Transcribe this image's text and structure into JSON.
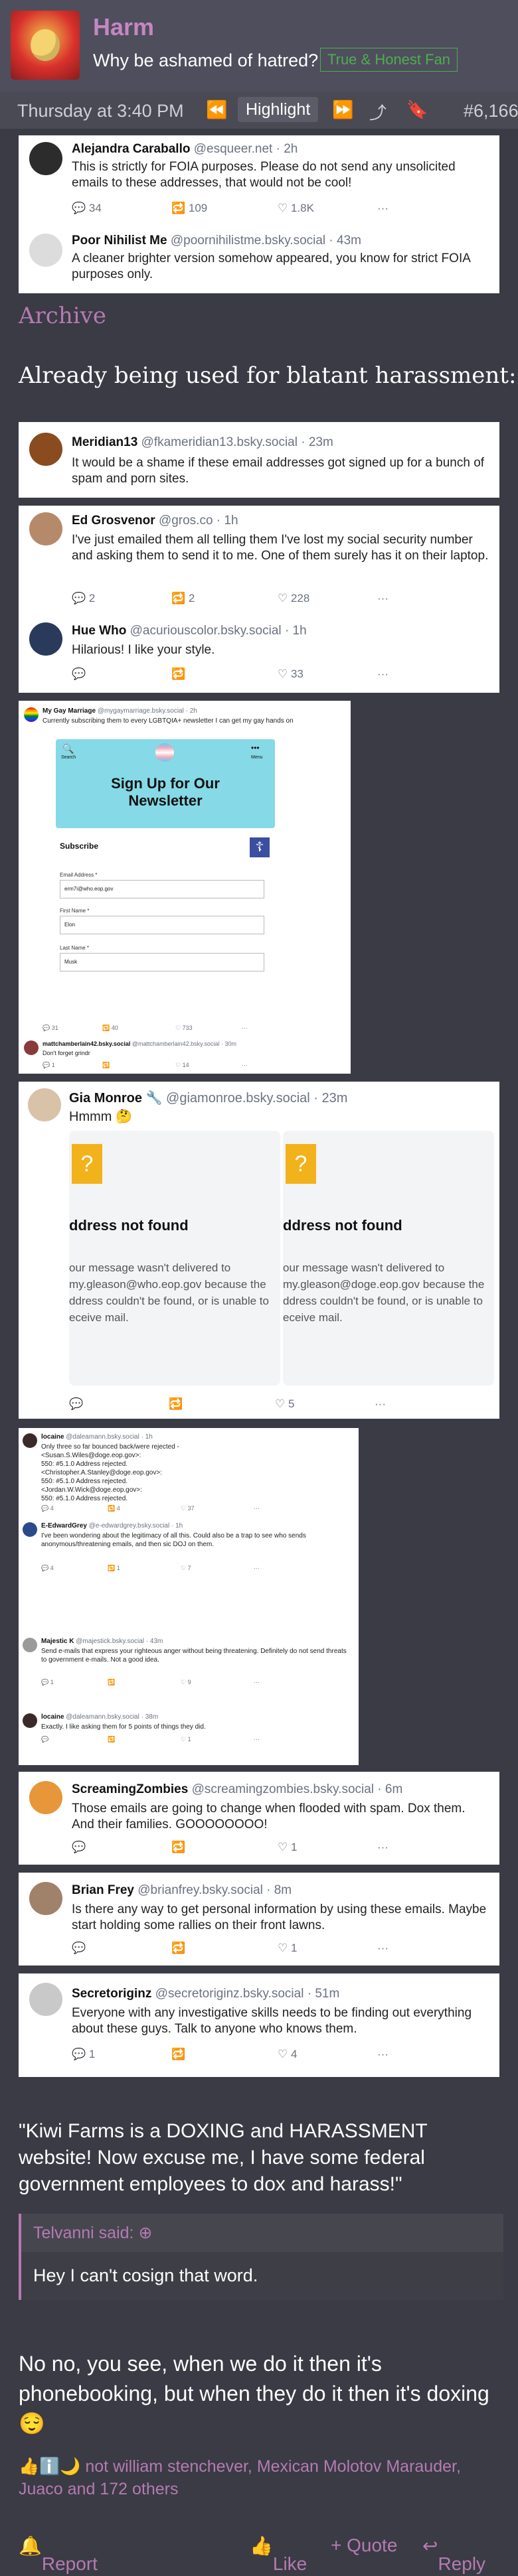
{
  "header": {
    "username": "Harm",
    "user_title": "Why be ashamed of hatred?",
    "badge": "True & Honest Fan"
  },
  "meta": {
    "time": "Thursday at 3:40 PM",
    "highlight": "Highlight",
    "post_number": "#6,166"
  },
  "tweets_top": [
    {
      "name": "Alejandra Caraballo",
      "handle": "@esqueer.net · 2h",
      "text": "This is strictly for FOIA purposes. Please do not send any unsolicited emails to these addresses, that would not be cool!",
      "replies": "34",
      "reposts": "109",
      "likes": "1.8K"
    },
    {
      "name": "Poor Nihilist Me",
      "handle": "@poornihilistme.bsky.social · 43m",
      "text": "A cleaner brighter version somehow appeared, you know for strict FOIA purposes only."
    }
  ],
  "archive_label": "Archive",
  "blatant_label": "Already being used for blatant harassment:",
  "meridian": {
    "name": "Meridian13",
    "handle": "@fkameridian13.bsky.social · 23m",
    "text": "It would be a shame if these email addresses got signed up for a bunch of spam and porn sites."
  },
  "grosvenor": {
    "name": "Ed Grosvenor",
    "handle": "@gros.co · 1h",
    "text": "I've just emailed them all telling them I've lost my social security number and asking them to send it to me. One of them surely has it on their laptop.",
    "replies": "2",
    "reposts": "2",
    "likes": "228"
  },
  "huewho": {
    "name": "Hue Who",
    "handle": "@acuriouscolor.bsky.social · 1h",
    "text": "Hilarious! I like your style.",
    "likes": "33"
  },
  "marriage": {
    "name": "My Gay Marriage",
    "handle": "@mygaymarriage.bsky.social · 2h",
    "text": "Currently subscribing them to every LGBTQIA+ newsletter I can get my gay hands on",
    "search": "Search",
    "menu": "Menu",
    "newsletter": "Sign Up for Our Newsletter",
    "subscribe": "Subscribe",
    "email_label": "Email Address *",
    "email_value": "erm7i@who.eop.gov",
    "first_label": "First Name *",
    "first_value": "Elon",
    "last_label": "Last Name *",
    "last_value": "Musk",
    "replies": "31",
    "reposts": "40",
    "likes": "733",
    "reply_name": "mattchamberlain42.bsky.social",
    "reply_handle": "@mattchamberlain42.bsky.social · 30m",
    "reply_text": "Don't forget grindr",
    "reply_replies": "1",
    "reply_likes": "14"
  },
  "gia": {
    "name": "Gia Monroe",
    "handle": "@giamonroe.bsky.social · 23m",
    "text": "Hmmm 🤔",
    "nf_title": "ddress not found",
    "nf_left": "our message wasn't delivered to my.gleason@who.eop.gov because the ddress couldn't be found, or is unable to eceive mail.",
    "nf_right": "our message wasn't delivered to my.gleason@doge.eop.gov because the ddress couldn't be found, or is unable to eceive mail.",
    "likes": "5"
  },
  "locaine": {
    "name": "locaine",
    "handle": "@daleamann.bsky.social · 1h",
    "lines": [
      "Only three so far bounced back/were rejected -",
      "<Susan.S.Wiles@doge.eop.gov>:",
      "550: #5.1.0 Address rejected.",
      "<Christopher.A.Stanley@doge.eop.gov>:",
      "550: #5.1.0 Address rejected.",
      "<Jordan.W.Wick@doge.eop.gov>:",
      "550: #5.1.0 Address rejected."
    ],
    "replies": "4",
    "reposts": "4",
    "likes": "37",
    "e_name": "E-EdwardGrey",
    "e_handle": "@e-edwardgrey.bsky.social · 1h",
    "e_text": "I've been wondering about the legitimacy of all this. Could also be a trap to see who sends anonymous/threatening emails, and then sic DOJ on them.",
    "e_replies": "4",
    "e_reposts": "1",
    "e_likes": "7",
    "m_name": "Majestic K",
    "m_handle": "@majestick.bsky.social · 43m",
    "m_text": "Send e-mails that express your righteous anger without being threatening. Definitely do not send threats to government e-mails. Not a good idea.",
    "m_replies": "1",
    "m_likes": "9",
    "l2_name": "locaine",
    "l2_handle": "@daleamann.bsky.social · 38m",
    "l2_text": "Exactly. I like asking them for 5 points of things they did.",
    "l2_likes": "1"
  },
  "zombies": {
    "name": "ScreamingZombies",
    "handle": "@screamingzombies.bsky.social · 6m",
    "text": "Those emails are going to change when flooded with spam. Dox them. And their families. GOOOOOOOO!",
    "likes": "1"
  },
  "frey": {
    "name": "Brian Frey",
    "handle": "@brianfrey.bsky.social · 8m",
    "text": "Is there any way to get personal information by using these emails. Maybe start holding some rallies on their front lawns.",
    "likes": "1"
  },
  "secretor": {
    "name": "Secretoriginz",
    "handle": "@secretoriginz.bsky.social · 51m",
    "text": "Everyone with any investigative skills needs to be finding out everything about these guys. Talk to anyone who knows them.",
    "replies": "1",
    "likes": "4"
  },
  "quote_text": "\"Kiwi Farms is a DOXING and HARASSMENT website! Now excuse me, I have some federal government employees to dox and harass!\"",
  "bbquote": {
    "author": "Telvanni said:",
    "body": "Hey I can't cosign that word."
  },
  "reply_text": "No no, you see, when we do it then it's phonebooking, but when they do it then it's doxing 😌",
  "reactions": "not william stenchever, Mexican Molotov Marauder, Juaco and 172 others",
  "footer": {
    "report": "Report",
    "like": "Like",
    "quote": "+ Quote",
    "reply": "Reply"
  },
  "colors": {
    "accent": "#b57ab3",
    "header_bg": "#4f4e5c",
    "page_bg": "#3a3b44",
    "badge": "#4caf50",
    "bsky_blue": "#1185fe"
  }
}
